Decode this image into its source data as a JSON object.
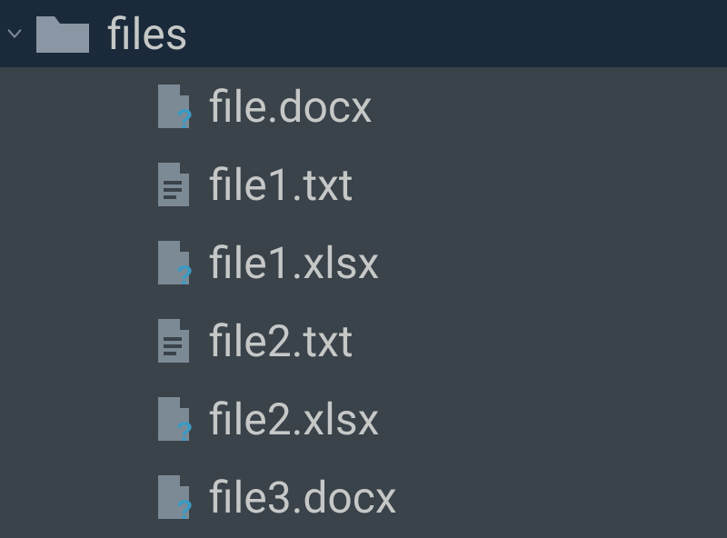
{
  "tree": {
    "folder": {
      "name": "files",
      "expanded": true,
      "children": [
        {
          "name": "file.docx",
          "icon": "unknown"
        },
        {
          "name": "file1.txt",
          "icon": "text"
        },
        {
          "name": "file1.xlsx",
          "icon": "unknown"
        },
        {
          "name": "file2.txt",
          "icon": "text"
        },
        {
          "name": "file2.xlsx",
          "icon": "unknown"
        },
        {
          "name": "file3.docx",
          "icon": "unknown"
        }
      ]
    }
  },
  "colors": {
    "header_bg": "#1a2a3a",
    "body_bg": "#3a424a",
    "text": "#c5c8c6",
    "icon": "#7c8a96",
    "accent": "#3a9bc4"
  }
}
